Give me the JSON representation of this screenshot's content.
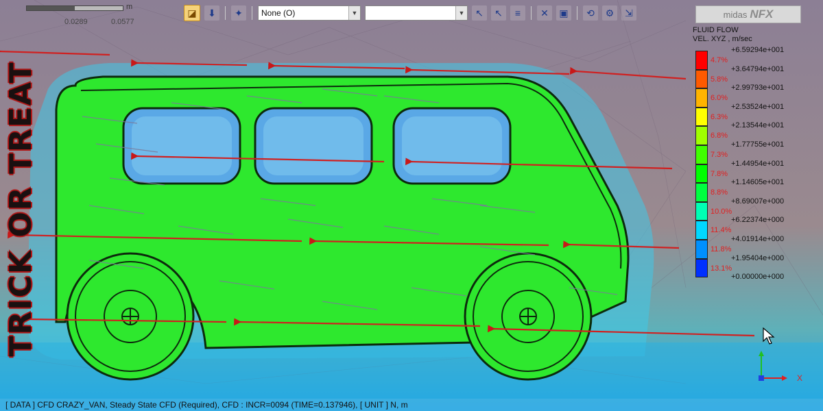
{
  "scale": {
    "unit": "m",
    "tick1": "0.0289",
    "tick2": "0.0577"
  },
  "toolbar": {
    "combo1_value": "None (O)",
    "combo2_value": ""
  },
  "logo": {
    "brand": "midas",
    "product": "NFX"
  },
  "legend": {
    "title_line1": "FLUID FLOW",
    "title_line2": "VEL. XYZ , m/sec",
    "values": [
      "+6.59294e+001",
      "+3.64794e+001",
      "+2.99793e+001",
      "+2.53524e+001",
      "+2.13544e+001",
      "+1.77755e+001",
      "+1.44954e+001",
      "+1.14605e+001",
      "+8.69007e+000",
      "+6.22374e+000",
      "+4.01914e+000",
      "+1.95404e+000",
      "+0.00000e+000"
    ],
    "percents": [
      "4.7%",
      "5.8%",
      "6.0%",
      "6.3%",
      "6.8%",
      "7.3%",
      "7.8%",
      "8.8%",
      "10.0%",
      "11.4%",
      "11.8%",
      "13.1%"
    ],
    "colors": [
      "#ff0000",
      "#ff5a00",
      "#ffb400",
      "#ffff00",
      "#a0ff00",
      "#40ff00",
      "#00ff00",
      "#00ff40",
      "#00ffb4",
      "#00d8ff",
      "#0090ff",
      "#0030ff"
    ]
  },
  "overlay_text": "TRICK OR TREAT",
  "status": "[ DATA ] CFD CRAZY_VAN,  Steady State CFD (Required),  CFD : INCR=0094 (TIME=0.137946),   [ UNIT ]   N,  m",
  "triad": {
    "x": "X"
  }
}
